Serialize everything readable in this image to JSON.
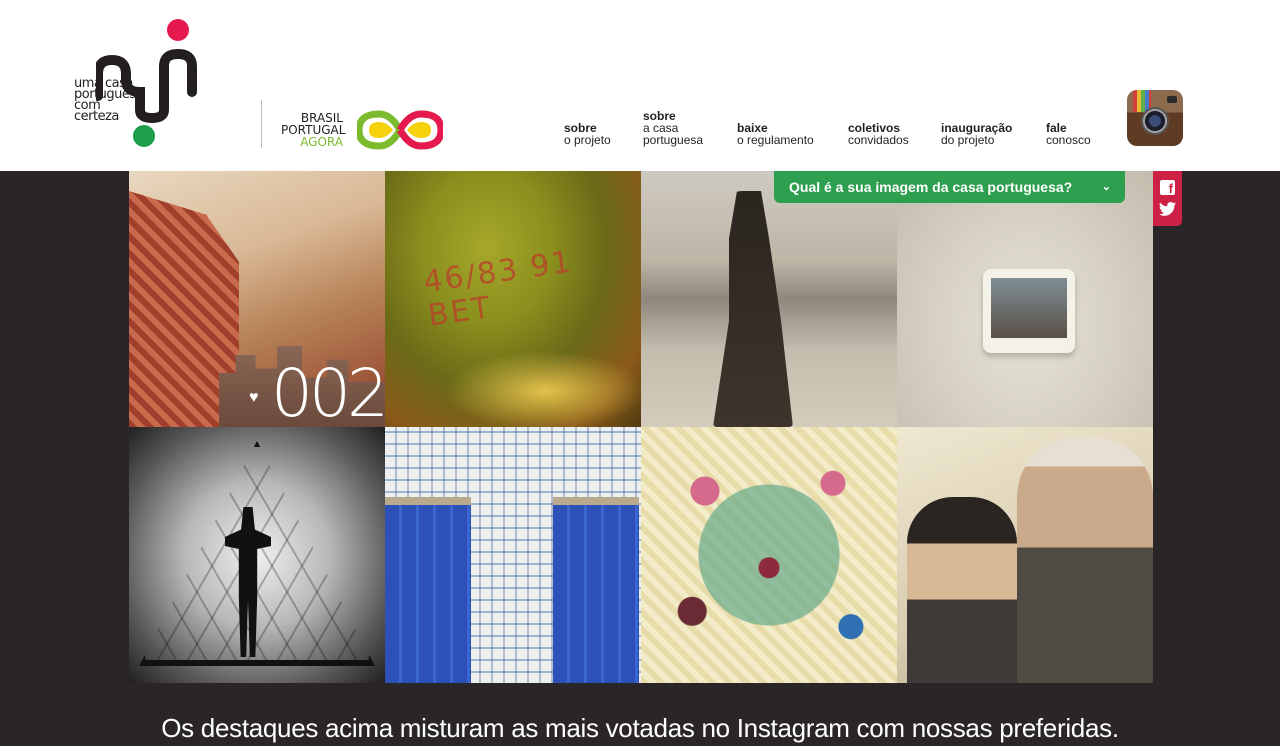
{
  "brand": {
    "logo_lines": [
      "uma casa",
      "portuguesa",
      "com",
      "certeza"
    ],
    "partner_lines": [
      "BRASIL",
      "PORTUGAL",
      "AGORA"
    ]
  },
  "nav": [
    {
      "bold": "sobre",
      "sub": "o projeto"
    },
    {
      "bold": "sobre",
      "sub": "a casa",
      "sub2": "portuguesa"
    },
    {
      "bold": "baixe",
      "sub": "o regulamento"
    },
    {
      "bold": "coletivos",
      "sub": "convidados"
    },
    {
      "bold": "inauguração",
      "sub": "do projeto"
    },
    {
      "bold": "fale",
      "sub": "conosco"
    }
  ],
  "question": {
    "label": "Qual é a sua imagem da casa portuguesa?",
    "chevron": "⌄"
  },
  "social": {
    "facebook": "f",
    "twitter": "🐦"
  },
  "grid": {
    "featured_counter": "002",
    "heart": "♥",
    "scrawl": "46/83 91 BET"
  },
  "caption": "Os destaques acima misturam as mais votadas no Instagram com nossas preferidas.",
  "icons": {
    "instagram": "instagram-icon",
    "facebook": "facebook-icon",
    "twitter": "twitter-icon",
    "logo": "casa-portuguesa-logo",
    "infinity": "brasil-portugal-infinity-logo"
  },
  "colors": {
    "accent_green": "#2d9f4f",
    "accent_red": "#cc2145",
    "logo_red": "#e5194e",
    "logo_green": "#1d9e4d",
    "background": "#2a2627"
  }
}
